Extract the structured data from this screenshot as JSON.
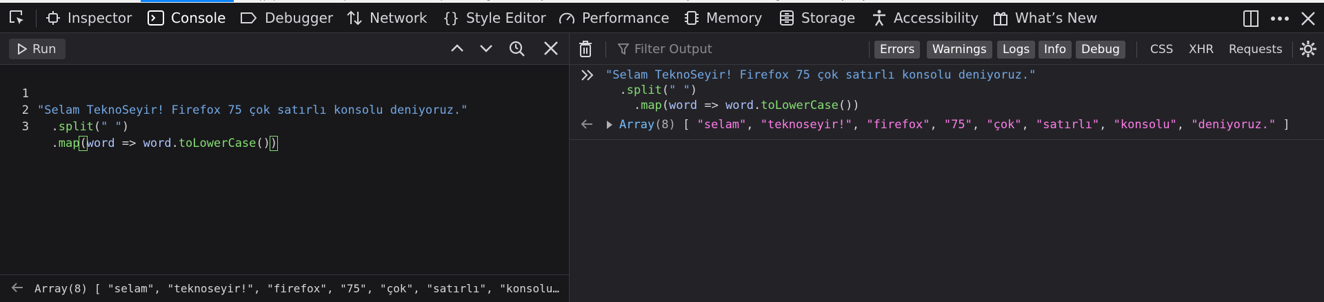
{
  "tabs": [
    {
      "label": "Inspector",
      "icon": "inspector-icon"
    },
    {
      "label": "Console",
      "icon": "console-icon",
      "selected": true
    },
    {
      "label": "Debugger",
      "icon": "debugger-icon"
    },
    {
      "label": "Network",
      "icon": "network-icon"
    },
    {
      "label": "Style Editor",
      "icon": "style-editor-icon"
    },
    {
      "label": "Performance",
      "icon": "performance-icon"
    },
    {
      "label": "Memory",
      "icon": "memory-icon"
    },
    {
      "label": "Storage",
      "icon": "storage-icon"
    },
    {
      "label": "Accessibility",
      "icon": "accessibility-icon"
    },
    {
      "label": "What’s New",
      "icon": "gift-icon"
    }
  ],
  "editor": {
    "run_label": "Run",
    "lines": [
      {
        "num": "1",
        "text": "\"Selam TeknoSeyir! Firefox 75 çok satırlı konsolu deniyoruz.\""
      },
      {
        "num": "2",
        "text": ".split(\" \")"
      },
      {
        "num": "3",
        "text": ".map(word => word.toLowerCase())"
      }
    ],
    "result_preview": "Array(8) [ \"selam\", \"teknoseyir!\", \"firefox\", \"75\", \"çok\", \"satırlı\", \"konsolu\",…"
  },
  "output": {
    "filter_placeholder": "Filter Output",
    "levels": [
      "Errors",
      "Warnings",
      "Logs",
      "Info",
      "Debug"
    ],
    "types": [
      "CSS",
      "XHR",
      "Requests"
    ],
    "input_lines": [
      "\"Selam TeknoSeyir! Firefox 75 çok satırlı konsolu deniyoruz.\"",
      "  .split(\" \")",
      "    .map(word => word.toLowerCase())"
    ],
    "result": {
      "type": "Array",
      "count": "(8)",
      "items": [
        "\"selam\"",
        "\"teknoseyir!\"",
        "\"firefox\"",
        "\"75\"",
        "\"çok\"",
        "\"satırlı\"",
        "\"konsolu\"",
        "\"deniyoruz.\""
      ]
    }
  }
}
